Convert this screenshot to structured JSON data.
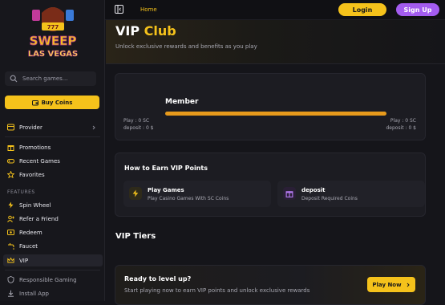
{
  "brand": {
    "logo_line1": "SWEEP",
    "logo_line2": "LAS VEGAS"
  },
  "colors": {
    "accent": "#f5c21b",
    "purple": "#a35cf0",
    "progress": "#e79a1c",
    "background": "#15151a"
  },
  "sidebar": {
    "search_placeholder": "Search games...",
    "buy_coins_label": "Buy Coins",
    "provider_label": "Provider",
    "items_main": [
      {
        "label": "Promotions",
        "icon": "gift-icon"
      },
      {
        "label": "Recent Games",
        "icon": "gamepad-icon"
      },
      {
        "label": "Favorites",
        "icon": "star-icon"
      }
    ],
    "features_label": "FEATURES",
    "items_features": [
      {
        "label": "Spin Wheel",
        "icon": "spin-wheel-icon"
      },
      {
        "label": "Refer a Friend",
        "icon": "user-plus-icon"
      },
      {
        "label": "Redeem",
        "icon": "redeem-icon"
      },
      {
        "label": "Faucet",
        "icon": "faucet-icon"
      },
      {
        "label": "VIP",
        "icon": "crown-icon"
      }
    ],
    "responsible_gaming_label": "Responsible Gaming",
    "install_app_label": "Install App"
  },
  "topbar": {
    "home_label": "Home",
    "login_label": "Login",
    "signup_label": "Sign Up"
  },
  "hero": {
    "title_white": "VIP",
    "title_accent": "Club",
    "subtitle": "Unlock exclusive rewards and benefits as you play"
  },
  "tier": {
    "current_tier": "Member",
    "progress_fraction": 1.0,
    "left_play": "Play : 0 SC",
    "left_deposit": "deposit : 0 $",
    "right_play": "Play : 0 SC",
    "right_deposit": "deposit : 0 $"
  },
  "earn": {
    "title": "How to Earn VIP Points",
    "items": [
      {
        "title": "Play Games",
        "desc": "Play Casino Games With SC Coins",
        "icon": "lightning-icon"
      },
      {
        "title": "deposit",
        "desc": "Deposit Required Coins",
        "icon": "gift-icon"
      }
    ]
  },
  "tiers_section": {
    "title": "VIP Tiers"
  },
  "cta": {
    "title": "Ready to level up?",
    "subtitle": "Start playing now to earn VIP points and unlock exclusive rewards",
    "button_label": "Play Now"
  }
}
